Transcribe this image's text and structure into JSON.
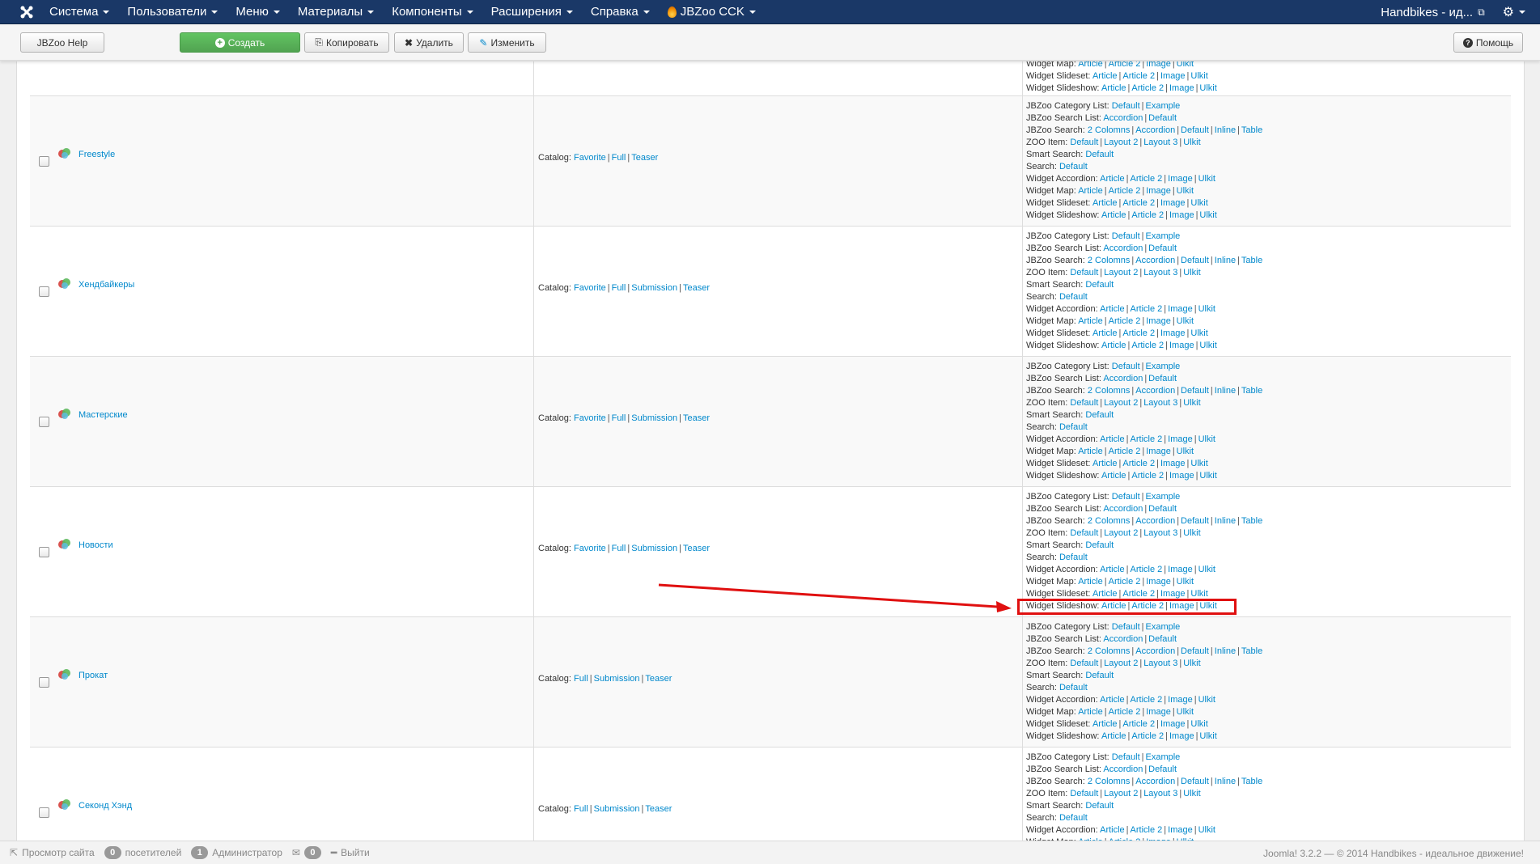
{
  "nav": {
    "items": [
      {
        "label": "Система"
      },
      {
        "label": "Пользователи"
      },
      {
        "label": "Меню"
      },
      {
        "label": "Материалы"
      },
      {
        "label": "Компоненты"
      },
      {
        "label": "Расширения"
      },
      {
        "label": "Справка"
      },
      {
        "label": "JBZoo CCK"
      }
    ],
    "site_label": "Handbikes - ид...",
    "colors": {
      "navbar": "#1a3867",
      "link": "#0088cc",
      "highlight": "#e01010",
      "success": "#51a351"
    }
  },
  "toolbar": {
    "help_label": "JBZoo Help",
    "create_label": "Создать",
    "copy_label": "Копировать",
    "delete_label": "Удалить",
    "edit_label": "Изменить",
    "help_right_label": "Помощь"
  },
  "rows": [
    {
      "name": "Freestyle",
      "catalog": [
        "Favorite",
        "Full",
        "Teaser"
      ]
    },
    {
      "name": "Хендбайкеры",
      "catalog": [
        "Favorite",
        "Full",
        "Submission",
        "Teaser"
      ]
    },
    {
      "name": "Мастерские",
      "catalog": [
        "Favorite",
        "Full",
        "Submission",
        "Teaser"
      ]
    },
    {
      "name": "Новости",
      "catalog": [
        "Favorite",
        "Full",
        "Submission",
        "Teaser"
      ]
    },
    {
      "name": "Прокат",
      "catalog": [
        "Full",
        "Submission",
        "Teaser"
      ]
    },
    {
      "name": "Секонд Хэнд",
      "catalog": [
        "Full",
        "Submission",
        "Teaser"
      ]
    }
  ],
  "catalog_label": "Catalog:",
  "layout_lines": [
    {
      "label": "JBZoo Category List:",
      "links": [
        "Default",
        "Example"
      ]
    },
    {
      "label": "JBZoo Search List:",
      "links": [
        "Accordion",
        "Default"
      ]
    },
    {
      "label": "JBZoo Search:",
      "links": [
        "2 Colomns",
        "Accordion",
        "Default",
        "Inline",
        "Table"
      ]
    },
    {
      "label": "ZOO Item:",
      "links": [
        "Default",
        "Layout 2",
        "Layout 3",
        "Ulkit"
      ]
    },
    {
      "label": "Smart Search:",
      "links": [
        "Default"
      ]
    },
    {
      "label": "Search:",
      "links": [
        "Default"
      ]
    },
    {
      "label": "Widget Accordion:",
      "links": [
        "Article",
        "Article 2",
        "Image",
        "Ulkit"
      ]
    },
    {
      "label": "Widget Map:",
      "links": [
        "Article",
        "Article 2",
        "Image",
        "Ulkit"
      ]
    },
    {
      "label": "Widget Slideset:",
      "links": [
        "Article",
        "Article 2",
        "Image",
        "Ulkit"
      ]
    },
    {
      "label": "Widget Slideshow:",
      "links": [
        "Article",
        "Article 2",
        "Image",
        "Ulkit"
      ]
    }
  ],
  "status": {
    "view_site": "Просмотр сайта",
    "visitors_count": "0",
    "visitors_label": "посетителей",
    "admins_count": "1",
    "admins_label": "Администратор",
    "messages_count": "0",
    "logout_label": "Выйти",
    "copyright": "Joomla! 3.2.2 — © 2014 Handbikes - идеальное движение!"
  }
}
